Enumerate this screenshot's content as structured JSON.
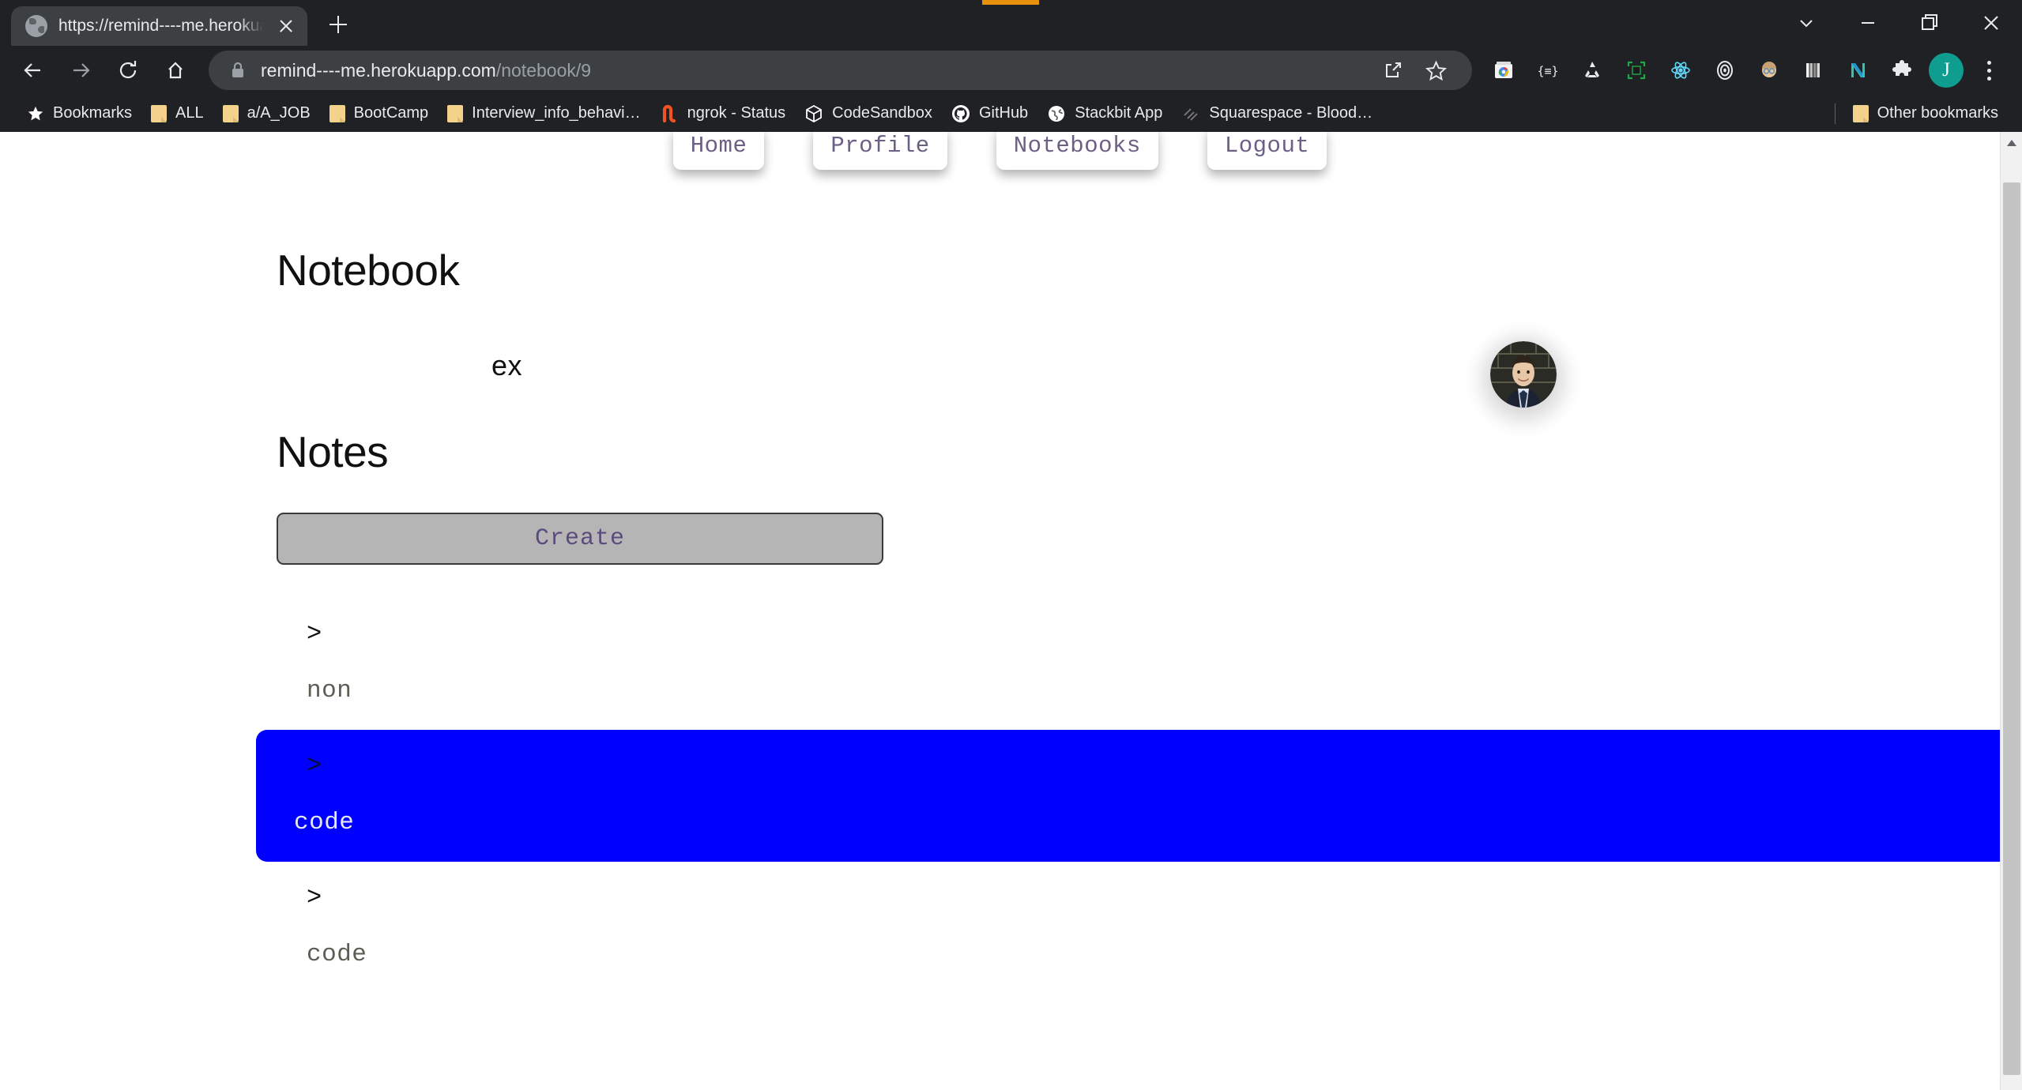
{
  "browser": {
    "window_controls": [
      {
        "name": "tab-search",
        "label": "Search tabs"
      },
      {
        "name": "minimize",
        "label": "Minimize"
      },
      {
        "name": "maximize",
        "label": "Restore"
      },
      {
        "name": "close",
        "label": "Close"
      }
    ],
    "tab": {
      "title": "https://remind----me.herokuapp.co",
      "favicon": "globe-icon",
      "close_label": "Close tab"
    },
    "new_tab_label": "New Tab",
    "toolbar": {
      "back_label": "Back",
      "forward_label": "Forward",
      "reload_label": "Reload",
      "home_label": "Home",
      "security_icon": "lock-icon",
      "url_domain": "remind----me.herokuapp.com",
      "url_path": "/notebook/9",
      "share_label": "Share this page",
      "bookmark_label": "Bookmark this tab",
      "profile_initial": "J",
      "menu_label": "Customize and control Google Chrome"
    },
    "extensions": [
      {
        "name": "chrome-web-store-extension",
        "label": "Web Store"
      },
      {
        "name": "json-viewer-extension",
        "label": "JSON Viewer"
      },
      {
        "name": "recycle-extension",
        "label": "Recycle"
      },
      {
        "name": "selector-extension",
        "label": "Selector"
      },
      {
        "name": "react-devtools-extension",
        "label": "React Developer Tools"
      },
      {
        "name": "target-extension",
        "label": "Target"
      },
      {
        "name": "avatar-extension",
        "label": "Avatar"
      },
      {
        "name": "stripes-extension",
        "label": "Stripes"
      },
      {
        "name": "netlify-extension",
        "label": "Netlify"
      },
      {
        "name": "puzzle-extensions",
        "label": "Extensions"
      }
    ],
    "bookmarks": [
      {
        "label": "Bookmarks",
        "icon": "star-icon"
      },
      {
        "label": "ALL",
        "icon": "folder-icon"
      },
      {
        "label": "a/A_JOB",
        "icon": "folder-icon"
      },
      {
        "label": "BootCamp",
        "icon": "folder-icon"
      },
      {
        "label": "Interview_info_behavi…",
        "icon": "folder-icon"
      },
      {
        "label": "ngrok - Status",
        "icon": "ngrok-icon"
      },
      {
        "label": "CodeSandbox",
        "icon": "codesandbox-icon"
      },
      {
        "label": "GitHub",
        "icon": "github-icon"
      },
      {
        "label": "Stackbit App",
        "icon": "globe-icon"
      },
      {
        "label": "Squarespace - Blood…",
        "icon": "squarespace-icon"
      }
    ],
    "other_bookmarks": {
      "label": "Other bookmarks",
      "icon": "folder-icon"
    }
  },
  "site": {
    "nav": [
      {
        "label": "Home",
        "name": "nav-home"
      },
      {
        "label": "Profile",
        "name": "nav-profile"
      },
      {
        "label": "Notebooks",
        "name": "nav-notebooks"
      },
      {
        "label": "Logout",
        "name": "nav-logout"
      }
    ],
    "notebook_heading": "Notebook",
    "notebook_name": "ex",
    "notes_heading": "Notes",
    "create_label": "Create",
    "notes": [
      {
        "chevron": ">",
        "title": "non",
        "selected": false
      },
      {
        "chevron": ">",
        "title": "code",
        "selected": true
      },
      {
        "chevron": ">",
        "title": "code",
        "selected": false
      }
    ],
    "avatar_label": "User avatar",
    "colors": {
      "selected_note_bg": "#0000ff",
      "create_button_bg": "#b5b5b5",
      "nav_text": "#6b5f86"
    }
  },
  "scrollbar": {
    "up_arrow_label": "Scroll up",
    "thumb_label": "Vertical scrollbar"
  }
}
